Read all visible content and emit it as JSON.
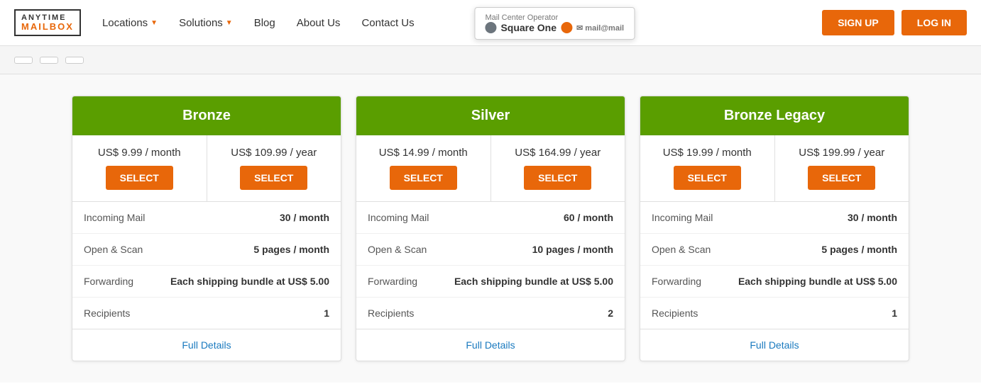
{
  "navbar": {
    "logo": {
      "line1": "ANYTIME",
      "line2": "MAILBOX"
    },
    "links": [
      {
        "label": "Locations",
        "has_dropdown": true
      },
      {
        "label": "Solutions",
        "has_dropdown": true
      },
      {
        "label": "Blog",
        "has_dropdown": false
      },
      {
        "label": "About Us",
        "has_dropdown": false
      },
      {
        "label": "Contact Us",
        "has_dropdown": false
      }
    ],
    "popup": {
      "title": "Mail Center Operator",
      "name": "Square One"
    },
    "signup_label": "SIGN UP",
    "login_label": "LOG IN"
  },
  "filter_bar": {
    "pills": [
      "",
      "",
      ""
    ]
  },
  "plans": [
    {
      "id": "bronze",
      "name": "Bronze",
      "monthly_price": "US$ 9.99 / month",
      "yearly_price": "US$ 109.99 / year",
      "select_label": "SELECT",
      "features": [
        {
          "label": "Incoming Mail",
          "value": "30 / month"
        },
        {
          "label": "Open & Scan",
          "value": "5 pages / month"
        },
        {
          "label": "Forwarding",
          "value": "Each shipping bundle at US$ 5.00"
        },
        {
          "label": "Recipients",
          "value": "1"
        }
      ],
      "full_details_label": "Full Details"
    },
    {
      "id": "silver",
      "name": "Silver",
      "monthly_price": "US$ 14.99 / month",
      "yearly_price": "US$ 164.99 / year",
      "select_label": "SELECT",
      "features": [
        {
          "label": "Incoming Mail",
          "value": "60 / month"
        },
        {
          "label": "Open & Scan",
          "value": "10 pages / month"
        },
        {
          "label": "Forwarding",
          "value": "Each shipping bundle at US$ 5.00"
        },
        {
          "label": "Recipients",
          "value": "2"
        }
      ],
      "full_details_label": "Full Details"
    },
    {
      "id": "bronze-legacy",
      "name": "Bronze Legacy",
      "monthly_price": "US$ 19.99 / month",
      "yearly_price": "US$ 199.99 / year",
      "select_label": "SELECT",
      "features": [
        {
          "label": "Incoming Mail",
          "value": "30 / month"
        },
        {
          "label": "Open & Scan",
          "value": "5 pages / month"
        },
        {
          "label": "Forwarding",
          "value": "Each shipping bundle at US$ 5.00"
        },
        {
          "label": "Recipients",
          "value": "1"
        }
      ],
      "full_details_label": "Full Details"
    }
  ]
}
